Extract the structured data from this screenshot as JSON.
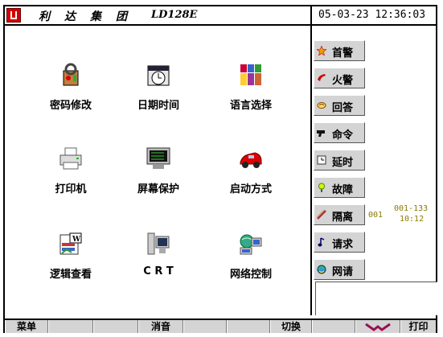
{
  "header": {
    "company": "利达集团",
    "model": "LD128E",
    "datetime": "05-03-23 12:36:03"
  },
  "apps": [
    {
      "label": "密码修改",
      "icon": "password-icon"
    },
    {
      "label": "日期时间",
      "icon": "clock-icon"
    },
    {
      "label": "语言选择",
      "icon": "language-icon"
    },
    {
      "label": "打印机",
      "icon": "printer-icon"
    },
    {
      "label": "屏幕保护",
      "icon": "monitor-icon"
    },
    {
      "label": "启动方式",
      "icon": "car-icon"
    },
    {
      "label": "逻辑查看",
      "icon": "logic-icon"
    },
    {
      "label": "C R T",
      "icon": "computer-icon"
    },
    {
      "label": "网络控制",
      "icon": "network-icon"
    }
  ],
  "sidebar": {
    "buttons": [
      {
        "label": "首警",
        "icon": "star-icon"
      },
      {
        "label": "火警",
        "icon": "fire-phone-icon"
      },
      {
        "label": "回答",
        "icon": "reply-icon"
      },
      {
        "label": "命令",
        "icon": "command-icon"
      },
      {
        "label": "延时",
        "icon": "delay-icon"
      },
      {
        "label": "故障",
        "icon": "fault-icon"
      },
      {
        "label": "隔离",
        "icon": "isolate-icon"
      },
      {
        "label": "请求",
        "icon": "request-icon"
      },
      {
        "label": "网请",
        "icon": "network-request-icon"
      }
    ],
    "isolate_count": "001",
    "isolate_range": "001-133",
    "isolate_time": "10:12"
  },
  "bottombar": {
    "menu": "菜单",
    "mute": "消音",
    "switch": "切换",
    "print": "打印"
  },
  "colors": {
    "button_face": "#d4d4d4",
    "status_text": "#8a7a00",
    "logo": "#d40000"
  }
}
